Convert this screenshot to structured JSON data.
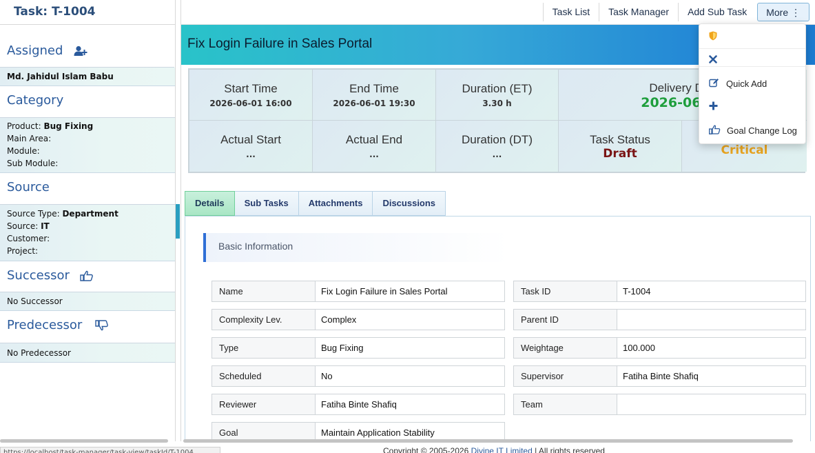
{
  "sidebar": {
    "task_header": "Task: T-1004",
    "assigned": {
      "title": "Assigned",
      "name": "Md. Jahidul Islam Babu"
    },
    "category": {
      "title": "Category",
      "product_label": "Product:",
      "product_value": "Bug Fixing",
      "main_area_label": "Main Area:",
      "module_label": "Module:",
      "sub_module_label": "Sub Module:"
    },
    "source": {
      "title": "Source",
      "type_label": "Source Type:",
      "type_value": "Department",
      "source_label": "Source:",
      "source_value": "IT",
      "customer_label": "Customer:",
      "project_label": "Project:"
    },
    "successor": {
      "title": "Successor",
      "value": "No Successor"
    },
    "predecessor": {
      "title": "Predecessor",
      "value": "No Predecessor"
    }
  },
  "topnav": {
    "task_list": "Task List",
    "task_manager": "Task Manager",
    "add_sub_task": "Add Sub Task",
    "more": "More ⋮"
  },
  "dropdown": {
    "quick_add": "Quick Add",
    "goal_change_log": "Goal Change Log"
  },
  "main": {
    "title": "Fix Login Failure in Sales Portal",
    "stats": {
      "start_time_label": "Start Time",
      "start_time_value": "2026-06-01 16:00",
      "end_time_label": "End Time",
      "end_time_value": "2026-06-01 19:30",
      "duration_et_label": "Duration (ET)",
      "duration_et_value": "3.30 h",
      "delivery_label": "Delivery Dea",
      "delivery_value": "2026-06-01",
      "actual_start_label": "Actual Start",
      "actual_start_value": "...",
      "actual_end_label": "Actual End",
      "actual_end_value": "...",
      "duration_dt_label": "Duration (DT)",
      "duration_dt_value": "...",
      "task_status_label": "Task Status",
      "task_status_value": "Draft",
      "priority_value": "Critical"
    },
    "tabs": [
      "Details",
      "Sub Tasks",
      "Attachments",
      "Discussions"
    ],
    "section_title": "Basic Information",
    "fields_left": [
      {
        "k": "Name",
        "v": "Fix Login Failure in Sales Portal"
      },
      {
        "k": "Complexity Lev.",
        "v": "Complex"
      },
      {
        "k": "Type",
        "v": "Bug Fixing"
      },
      {
        "k": "Scheduled",
        "v": "No"
      },
      {
        "k": "Reviewer",
        "v": "Fatiha Binte Shafiq"
      },
      {
        "k": "Goal",
        "v": "Maintain Application Stability"
      }
    ],
    "fields_right": [
      {
        "k": "Task ID",
        "v": "T-1004"
      },
      {
        "k": "Parent ID",
        "v": ""
      },
      {
        "k": "Weightage",
        "v": "100.000"
      },
      {
        "k": "Supervisor",
        "v": "Fatiha Binte Shafiq"
      },
      {
        "k": "Team",
        "v": ""
      }
    ]
  },
  "footer": {
    "status_url": "https://localhost/task-manager/task-view/taskId/T-1004",
    "copyright_prefix": "Copyright © 2005-2026",
    "copyright_company": "Divine IT Limited",
    "copyright_suffix": "| All rights reserved"
  },
  "colors": {
    "accent": "#2a5a9c",
    "title_gradient_start": "#29c3c9",
    "title_gradient_end": "#1c7bd0",
    "status_draft": "#7a1515",
    "priority_critical": "#e8a420",
    "deadline_green": "#1e9e3c"
  }
}
